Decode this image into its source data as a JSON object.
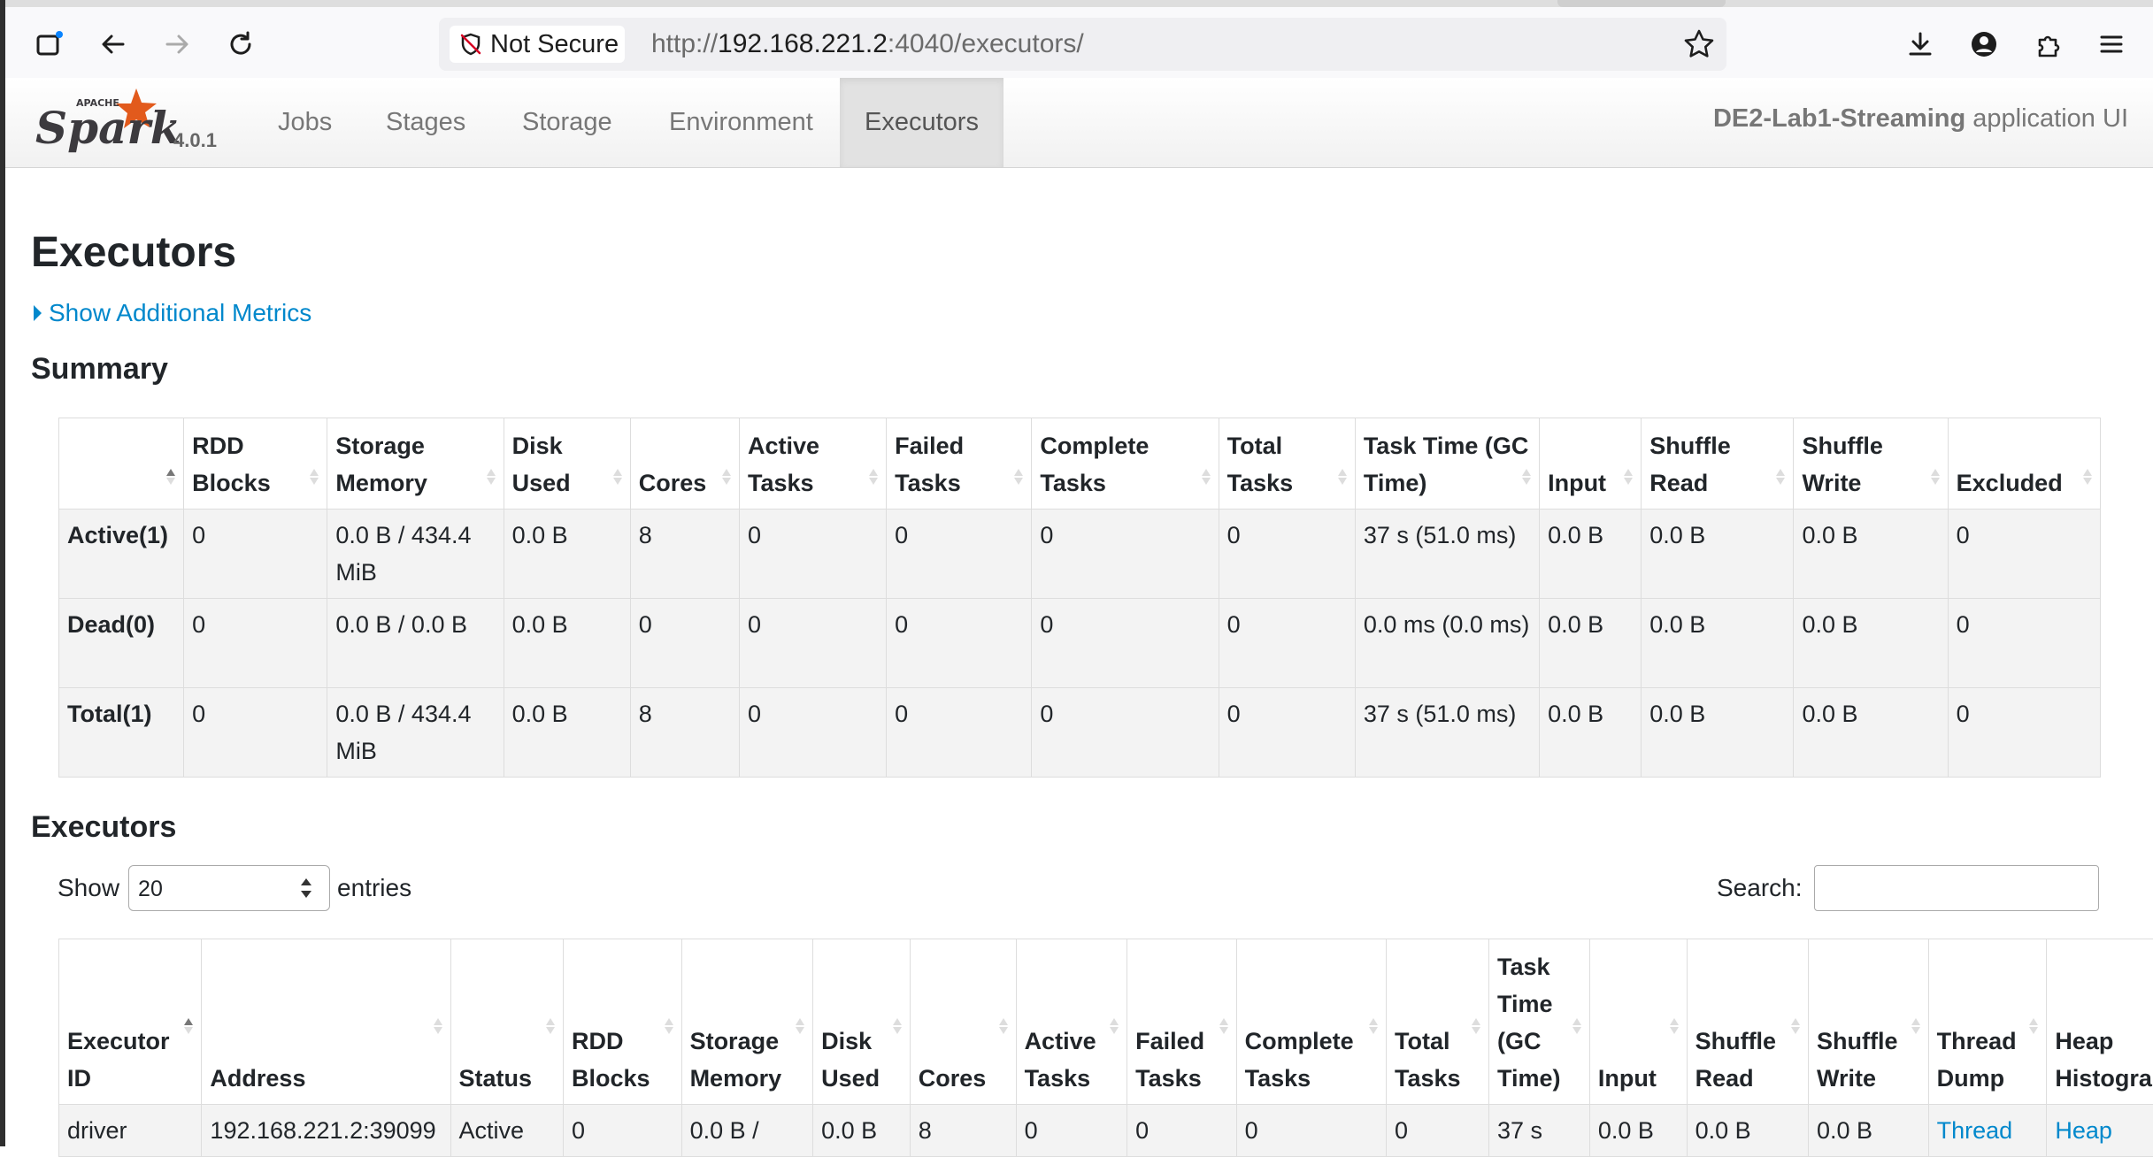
{
  "browser": {
    "security_label": "Not Secure",
    "url_scheme": "http://",
    "url_host": "192.168.221.2",
    "url_rest": ":4040/executors/"
  },
  "navbar": {
    "version": "4.0.1",
    "items": [
      "Jobs",
      "Stages",
      "Storage",
      "Environment",
      "Executors"
    ],
    "active": "Executors",
    "app_name": "DE2-Lab1-Streaming",
    "app_suffix": "application UI"
  },
  "page": {
    "title": "Executors",
    "additional_metrics": "Show Additional Metrics",
    "summary_title": "Summary",
    "executors_title": "Executors"
  },
  "summary": {
    "headers": [
      "",
      "RDD Blocks",
      "Storage Memory",
      "Disk Used",
      "Cores",
      "Active Tasks",
      "Failed Tasks",
      "Complete Tasks",
      "Total Tasks",
      "Task Time (GC Time)",
      "Input",
      "Shuffle Read",
      "Shuffle Write",
      "Excluded"
    ],
    "rows": [
      [
        "Active(1)",
        "0",
        "0.0 B / 434.4 MiB",
        "0.0 B",
        "8",
        "0",
        "0",
        "0",
        "0",
        "37 s (51.0 ms)",
        "0.0 B",
        "0.0 B",
        "0.0 B",
        "0"
      ],
      [
        "Dead(0)",
        "0",
        "0.0 B / 0.0 B",
        "0.0 B",
        "0",
        "0",
        "0",
        "0",
        "0",
        "0.0 ms (0.0 ms)",
        "0.0 B",
        "0.0 B",
        "0.0 B",
        "0"
      ],
      [
        "Total(1)",
        "0",
        "0.0 B / 434.4 MiB",
        "0.0 B",
        "8",
        "0",
        "0",
        "0",
        "0",
        "37 s (51.0 ms)",
        "0.0 B",
        "0.0 B",
        "0.0 B",
        "0"
      ]
    ]
  },
  "executors": {
    "show_label": "Show",
    "entries_value": "20",
    "entries_label": "entries",
    "search_label": "Search:",
    "headers": [
      "Executor ID",
      "Address",
      "Status",
      "RDD Blocks",
      "Storage Memory",
      "Disk Used",
      "Cores",
      "Active Tasks",
      "Failed Tasks",
      "Complete Tasks",
      "Total Tasks",
      "Task Time (GC Time)",
      "Input",
      "Shuffle Read",
      "Shuffle Write",
      "Thread Dump",
      "Heap Histogram"
    ],
    "rows": [
      [
        "driver",
        "192.168.221.2:39099",
        "Active",
        "0",
        "0.0 B /",
        "0.0 B",
        "8",
        "0",
        "0",
        "0",
        "0",
        "37 s",
        "0.0 B",
        "0.0 B",
        "0.0 B",
        "Thread",
        "Heap"
      ]
    ]
  }
}
